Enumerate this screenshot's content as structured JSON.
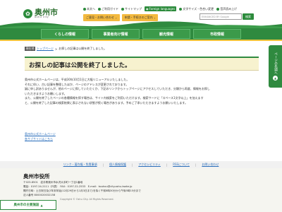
{
  "logo": {
    "kanji": "奥州市",
    "roman": "oshu city"
  },
  "util_links": [
    {
      "label": "本文へ",
      "icon": "arrow-icon"
    },
    {
      "label": "ご利用ガイド",
      "icon": "guide-icon"
    },
    {
      "label": "サイトマップ",
      "icon": "sitemap-icon"
    },
    {
      "label": "Foreign languages",
      "icon": "globe-icon"
    },
    {
      "label": "文字サイズ・色合い変更",
      "icon": "text-size-icon"
    },
    {
      "label": "音声読み上げ",
      "icon": "speaker-icon"
    }
  ],
  "quick_links": [
    {
      "label": "ご意見・お問い合わせ"
    },
    {
      "label": "申請・手続きのご案内"
    }
  ],
  "search": {
    "placeholder": "ENHANCED BY Google",
    "button": "検索"
  },
  "nav": [
    {
      "label": "くらしの情報"
    },
    {
      "label": "事業者向け情報"
    },
    {
      "label": "観光情報"
    },
    {
      "label": "市政情報"
    }
  ],
  "breadcrumb": {
    "here": "現在地",
    "home": "トップページ",
    "sep": ">",
    "current": "お探しの記事は公開を終了しました。"
  },
  "page_title": "お探しの記事は公開を終了しました。",
  "body": [
    "奥州市公式ホームページは、平成30年10月1日に大幅リニューアルいたしました。",
    "それに伴い、古い記事を整理したほか、ページのアドレスが変更されております。",
    "誠に申し訳ありませんが、他のページに探していただくか、下記のリンクからトップページにアクセスしていただき、分類から再度、情報をお探し",
    "いただきますようお願いします。",
    "また、公開を終了したページの各種情報を探す場合は、サイト内検索をご利用いただけます。検索ワードに「スペース1文字以上」を加えます",
    "と、公開を終了した記事の検索結果に表示されない状態が続く場合があります。予めご了承いただきますようお願いいたします。"
  ],
  "links": [
    "奥州市公式ホームページ",
    "各サブサイトはこちら"
  ],
  "side_tab": {
    "label": "ページの先頭へ",
    "arrow": "▲"
  },
  "footer_links": [
    {
      "label": "リンク・著作権・免責事項"
    },
    {
      "label": "個人情報保護"
    },
    {
      "label": "アクセシビリティ"
    },
    {
      "label": "RSSについて"
    },
    {
      "label": "お問い合わせ"
    }
  ],
  "footer": {
    "name": "奥州市役所",
    "address": "〒023-8501　岩手県奥州市水沢大手町一丁目1番地",
    "tel": "電話：0197-24-2111（代表）　FAX：0197-22-2533　E-mail：kouhou@city.oshu.iwate.jp",
    "hours": "開庁日時：土日祝日及び年末年始(12月29日から1月3日まで)を除く午前8時30分から午後5時15分まで",
    "corp": "法人番号 8000020032158",
    "copyright": "Copyright © Oshu City. All Rights Reserved."
  },
  "badge": {
    "label": "奥州市の主要施設",
    "arrow": "▲"
  },
  "colors": {
    "brand": "#2f8a3f",
    "accent": "#f2c53d",
    "title_bg": "#f7f2cf",
    "link": "#2a6ebb"
  }
}
